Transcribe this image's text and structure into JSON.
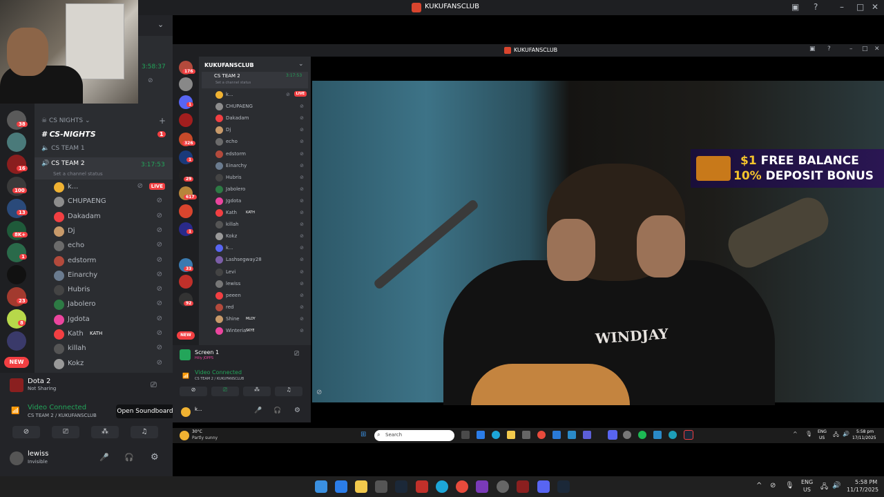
{
  "window": {
    "title": "KUKUFANSCLUB"
  },
  "inner_window": {
    "title": "KUKUFANSCLUB"
  },
  "webcam_sidebar": {
    "timer": "3:58:37"
  },
  "server_badges": [
    "38",
    "16",
    "100",
    "13",
    "8K+",
    "1",
    "23",
    "8"
  ],
  "new_label": "NEW",
  "channels": {
    "category": "CS NIGHTS",
    "text_channel": "CS-NIGHTS",
    "text_badge": "1",
    "voice1": "CS TEAM 1",
    "voice2": "CS TEAM 2",
    "voice2_timer": "3:17:53",
    "voice2_status": "Set a channel status",
    "members": [
      {
        "name": "k...",
        "live": "LIVE",
        "color": "#f0b232"
      },
      {
        "name": "CHUPAENG",
        "color": "#8d8d8d"
      },
      {
        "name": "Dakadam",
        "color": "#f23f42"
      },
      {
        "name": "Dj",
        "color": "#c89a6a"
      },
      {
        "name": "echo",
        "color": "#6b6b6b"
      },
      {
        "name": "edstorm",
        "color": "#b34a3c"
      },
      {
        "name": "Einarchy",
        "color": "#6a7b8f"
      },
      {
        "name": "Hubris",
        "color": "#444"
      },
      {
        "name": "Jabolero",
        "color": "#2d7a44"
      },
      {
        "name": "Jgdota",
        "color": "#eb459e"
      },
      {
        "name": "Kath",
        "tag": "KATH",
        "color": "#f23f42"
      },
      {
        "name": "killah",
        "color": "#555"
      },
      {
        "name": "Kokz",
        "color": "#999"
      }
    ]
  },
  "voice_panel": {
    "game": "Dota 2",
    "game_status": "Not Sharing",
    "connected": "Video Connected",
    "location": "CS TEAM 2 / KUKUFANSCLUB",
    "tooltip": "Open Soundboard",
    "user": "lewiss",
    "user_status": "Invisible"
  },
  "inner": {
    "server_header": "KUKUFANSCLUB",
    "voice_channel": "CS TEAM 2",
    "voice_timer": "3:17:53",
    "voice_status": "Set a channel status",
    "members": [
      {
        "name": "k...",
        "color": "#f0b232",
        "live": "LIVE"
      },
      {
        "name": "CHUPAENG",
        "color": "#8d8d8d"
      },
      {
        "name": "Dakadam",
        "color": "#f23f42"
      },
      {
        "name": "Dj",
        "color": "#c89a6a"
      },
      {
        "name": "echo",
        "color": "#6b6b6b"
      },
      {
        "name": "edstorm",
        "color": "#b34a3c"
      },
      {
        "name": "Einarchy",
        "color": "#6a7b8f"
      },
      {
        "name": "Hubris",
        "color": "#444"
      },
      {
        "name": "Jabolero",
        "color": "#2d7a44"
      },
      {
        "name": "Jgdota",
        "color": "#eb459e"
      },
      {
        "name": "Kath",
        "color": "#f23f42",
        "tag": "KATH"
      },
      {
        "name": "killah",
        "color": "#555"
      },
      {
        "name": "Kokz",
        "color": "#999"
      },
      {
        "name": "k...",
        "color": "#5865f2"
      },
      {
        "name": "Lashsegway28",
        "color": "#7b5ea7"
      },
      {
        "name": "Levi",
        "color": "#444"
      },
      {
        "name": "lewiss",
        "color": "#777"
      },
      {
        "name": "peeen",
        "color": "#f23f42"
      },
      {
        "name": "red",
        "color": "#b34a3c"
      },
      {
        "name": "Shine",
        "color": "#c89a6a",
        "tag": "MLDY"
      },
      {
        "name": "Winteria",
        "color": "#eb459e",
        "tag": "SKYE"
      }
    ],
    "screen_label": "Screen 1",
    "screen_sub": "Hilly JOPPS",
    "connected": "Video Connected",
    "location": "CS TEAM 2 / KUKUFANSCLUB",
    "user": "k...",
    "new_label": "NEW",
    "rail_badges": [
      "176",
      "1",
      "326",
      "1",
      "29",
      "617",
      "1",
      "33",
      "92"
    ]
  },
  "promo": {
    "amount": "$1",
    "line1_rest": " FREE BALANCE",
    "pct": "10%",
    "line2_rest": " DEPOSIT BONUS"
  },
  "video": {
    "shirt_text": "WINDJAY"
  },
  "inner_taskbar": {
    "weather_temp": "30°C",
    "weather_desc": "Partly sunny",
    "search_placeholder": "Search",
    "lang": "ENG",
    "region": "US",
    "time": "5:58 pm",
    "date": "17/11/2025"
  },
  "taskbar": {
    "lang": "ENG",
    "region": "US",
    "time": "5:58 PM",
    "date": "11/17/2025"
  }
}
